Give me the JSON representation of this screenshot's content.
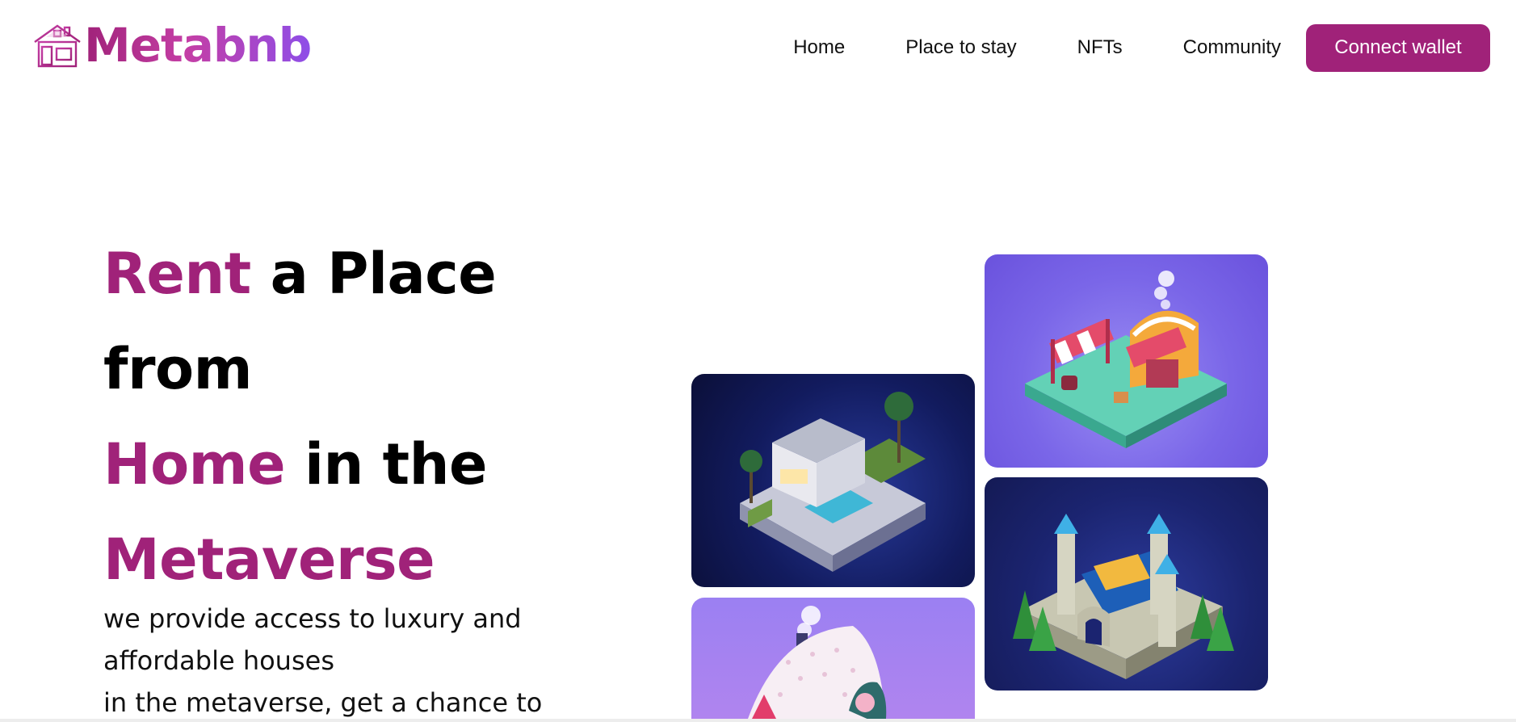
{
  "brand": {
    "name": "Metabnb",
    "icon": "house-icon"
  },
  "nav": {
    "items": [
      {
        "label": "Home"
      },
      {
        "label": "Place to stay"
      },
      {
        "label": "NFTs"
      },
      {
        "label": "Community"
      }
    ],
    "cta_label": "Connect wallet"
  },
  "hero": {
    "title": {
      "word_rent": "Rent",
      "rest_line1": "a Place",
      "line2": "from",
      "word_home": "Home",
      "rest_line3": "in the",
      "word_metaverse": "Metaverse"
    },
    "subtitle_lines": [
      "we provide access to luxury and",
      "affordable houses",
      "in the metaverse, get a chance to"
    ]
  },
  "images": [
    {
      "name": "villa-image"
    },
    {
      "name": "market-image"
    },
    {
      "name": "castle-image"
    },
    {
      "name": "cottage-image"
    }
  ],
  "colors": {
    "accent": "#a02279",
    "logo_gradient_end": "#8e4ee8"
  }
}
